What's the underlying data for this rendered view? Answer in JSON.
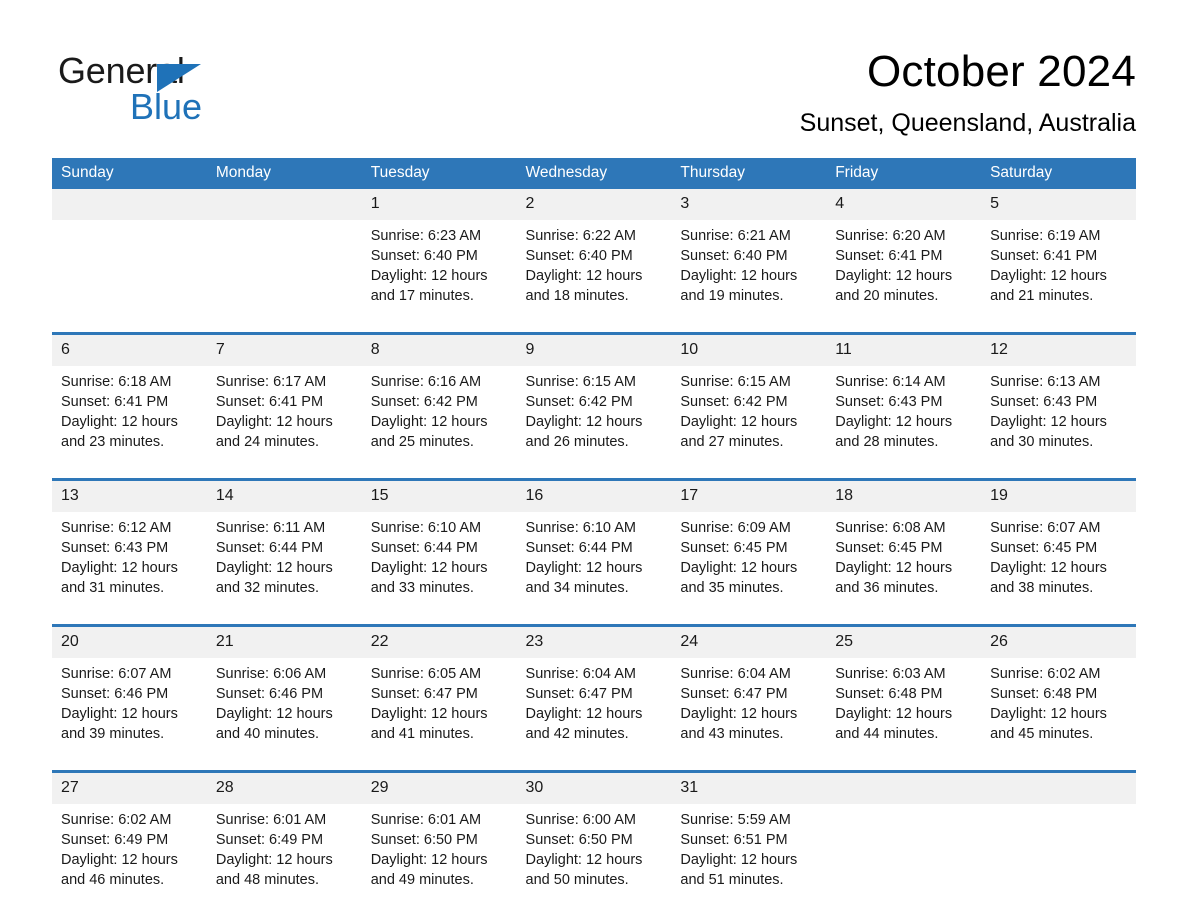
{
  "brand": {
    "name_part1": "General",
    "name_part2": "Blue",
    "logo_icon": "triangle-flag-icon",
    "accent_color": "#1f72b8"
  },
  "header": {
    "month_title": "October 2024",
    "location": "Sunset, Queensland, Australia"
  },
  "calendar": {
    "header_bg": "#2e77b8",
    "date_band_bg": "#f1f1f1",
    "weekdays": [
      "Sunday",
      "Monday",
      "Tuesday",
      "Wednesday",
      "Thursday",
      "Friday",
      "Saturday"
    ],
    "weeks": [
      {
        "days": [
          {
            "date": "",
            "lines": [
              "",
              "",
              "",
              ""
            ]
          },
          {
            "date": "",
            "lines": [
              "",
              "",
              "",
              ""
            ]
          },
          {
            "date": "1",
            "lines": [
              "Sunrise: 6:23 AM",
              "Sunset: 6:40 PM",
              "Daylight: 12 hours",
              "and 17 minutes."
            ]
          },
          {
            "date": "2",
            "lines": [
              "Sunrise: 6:22 AM",
              "Sunset: 6:40 PM",
              "Daylight: 12 hours",
              "and 18 minutes."
            ]
          },
          {
            "date": "3",
            "lines": [
              "Sunrise: 6:21 AM",
              "Sunset: 6:40 PM",
              "Daylight: 12 hours",
              "and 19 minutes."
            ]
          },
          {
            "date": "4",
            "lines": [
              "Sunrise: 6:20 AM",
              "Sunset: 6:41 PM",
              "Daylight: 12 hours",
              "and 20 minutes."
            ]
          },
          {
            "date": "5",
            "lines": [
              "Sunrise: 6:19 AM",
              "Sunset: 6:41 PM",
              "Daylight: 12 hours",
              "and 21 minutes."
            ]
          }
        ]
      },
      {
        "days": [
          {
            "date": "6",
            "lines": [
              "Sunrise: 6:18 AM",
              "Sunset: 6:41 PM",
              "Daylight: 12 hours",
              "and 23 minutes."
            ]
          },
          {
            "date": "7",
            "lines": [
              "Sunrise: 6:17 AM",
              "Sunset: 6:41 PM",
              "Daylight: 12 hours",
              "and 24 minutes."
            ]
          },
          {
            "date": "8",
            "lines": [
              "Sunrise: 6:16 AM",
              "Sunset: 6:42 PM",
              "Daylight: 12 hours",
              "and 25 minutes."
            ]
          },
          {
            "date": "9",
            "lines": [
              "Sunrise: 6:15 AM",
              "Sunset: 6:42 PM",
              "Daylight: 12 hours",
              "and 26 minutes."
            ]
          },
          {
            "date": "10",
            "lines": [
              "Sunrise: 6:15 AM",
              "Sunset: 6:42 PM",
              "Daylight: 12 hours",
              "and 27 minutes."
            ]
          },
          {
            "date": "11",
            "lines": [
              "Sunrise: 6:14 AM",
              "Sunset: 6:43 PM",
              "Daylight: 12 hours",
              "and 28 minutes."
            ]
          },
          {
            "date": "12",
            "lines": [
              "Sunrise: 6:13 AM",
              "Sunset: 6:43 PM",
              "Daylight: 12 hours",
              "and 30 minutes."
            ]
          }
        ]
      },
      {
        "days": [
          {
            "date": "13",
            "lines": [
              "Sunrise: 6:12 AM",
              "Sunset: 6:43 PM",
              "Daylight: 12 hours",
              "and 31 minutes."
            ]
          },
          {
            "date": "14",
            "lines": [
              "Sunrise: 6:11 AM",
              "Sunset: 6:44 PM",
              "Daylight: 12 hours",
              "and 32 minutes."
            ]
          },
          {
            "date": "15",
            "lines": [
              "Sunrise: 6:10 AM",
              "Sunset: 6:44 PM",
              "Daylight: 12 hours",
              "and 33 minutes."
            ]
          },
          {
            "date": "16",
            "lines": [
              "Sunrise: 6:10 AM",
              "Sunset: 6:44 PM",
              "Daylight: 12 hours",
              "and 34 minutes."
            ]
          },
          {
            "date": "17",
            "lines": [
              "Sunrise: 6:09 AM",
              "Sunset: 6:45 PM",
              "Daylight: 12 hours",
              "and 35 minutes."
            ]
          },
          {
            "date": "18",
            "lines": [
              "Sunrise: 6:08 AM",
              "Sunset: 6:45 PM",
              "Daylight: 12 hours",
              "and 36 minutes."
            ]
          },
          {
            "date": "19",
            "lines": [
              "Sunrise: 6:07 AM",
              "Sunset: 6:45 PM",
              "Daylight: 12 hours",
              "and 38 minutes."
            ]
          }
        ]
      },
      {
        "days": [
          {
            "date": "20",
            "lines": [
              "Sunrise: 6:07 AM",
              "Sunset: 6:46 PM",
              "Daylight: 12 hours",
              "and 39 minutes."
            ]
          },
          {
            "date": "21",
            "lines": [
              "Sunrise: 6:06 AM",
              "Sunset: 6:46 PM",
              "Daylight: 12 hours",
              "and 40 minutes."
            ]
          },
          {
            "date": "22",
            "lines": [
              "Sunrise: 6:05 AM",
              "Sunset: 6:47 PM",
              "Daylight: 12 hours",
              "and 41 minutes."
            ]
          },
          {
            "date": "23",
            "lines": [
              "Sunrise: 6:04 AM",
              "Sunset: 6:47 PM",
              "Daylight: 12 hours",
              "and 42 minutes."
            ]
          },
          {
            "date": "24",
            "lines": [
              "Sunrise: 6:04 AM",
              "Sunset: 6:47 PM",
              "Daylight: 12 hours",
              "and 43 minutes."
            ]
          },
          {
            "date": "25",
            "lines": [
              "Sunrise: 6:03 AM",
              "Sunset: 6:48 PM",
              "Daylight: 12 hours",
              "and 44 minutes."
            ]
          },
          {
            "date": "26",
            "lines": [
              "Sunrise: 6:02 AM",
              "Sunset: 6:48 PM",
              "Daylight: 12 hours",
              "and 45 minutes."
            ]
          }
        ]
      },
      {
        "days": [
          {
            "date": "27",
            "lines": [
              "Sunrise: 6:02 AM",
              "Sunset: 6:49 PM",
              "Daylight: 12 hours",
              "and 46 minutes."
            ]
          },
          {
            "date": "28",
            "lines": [
              "Sunrise: 6:01 AM",
              "Sunset: 6:49 PM",
              "Daylight: 12 hours",
              "and 48 minutes."
            ]
          },
          {
            "date": "29",
            "lines": [
              "Sunrise: 6:01 AM",
              "Sunset: 6:50 PM",
              "Daylight: 12 hours",
              "and 49 minutes."
            ]
          },
          {
            "date": "30",
            "lines": [
              "Sunrise: 6:00 AM",
              "Sunset: 6:50 PM",
              "Daylight: 12 hours",
              "and 50 minutes."
            ]
          },
          {
            "date": "31",
            "lines": [
              "Sunrise: 5:59 AM",
              "Sunset: 6:51 PM",
              "Daylight: 12 hours",
              "and 51 minutes."
            ]
          },
          {
            "date": "",
            "lines": [
              "",
              "",
              "",
              ""
            ]
          },
          {
            "date": "",
            "lines": [
              "",
              "",
              "",
              ""
            ]
          }
        ]
      }
    ]
  }
}
